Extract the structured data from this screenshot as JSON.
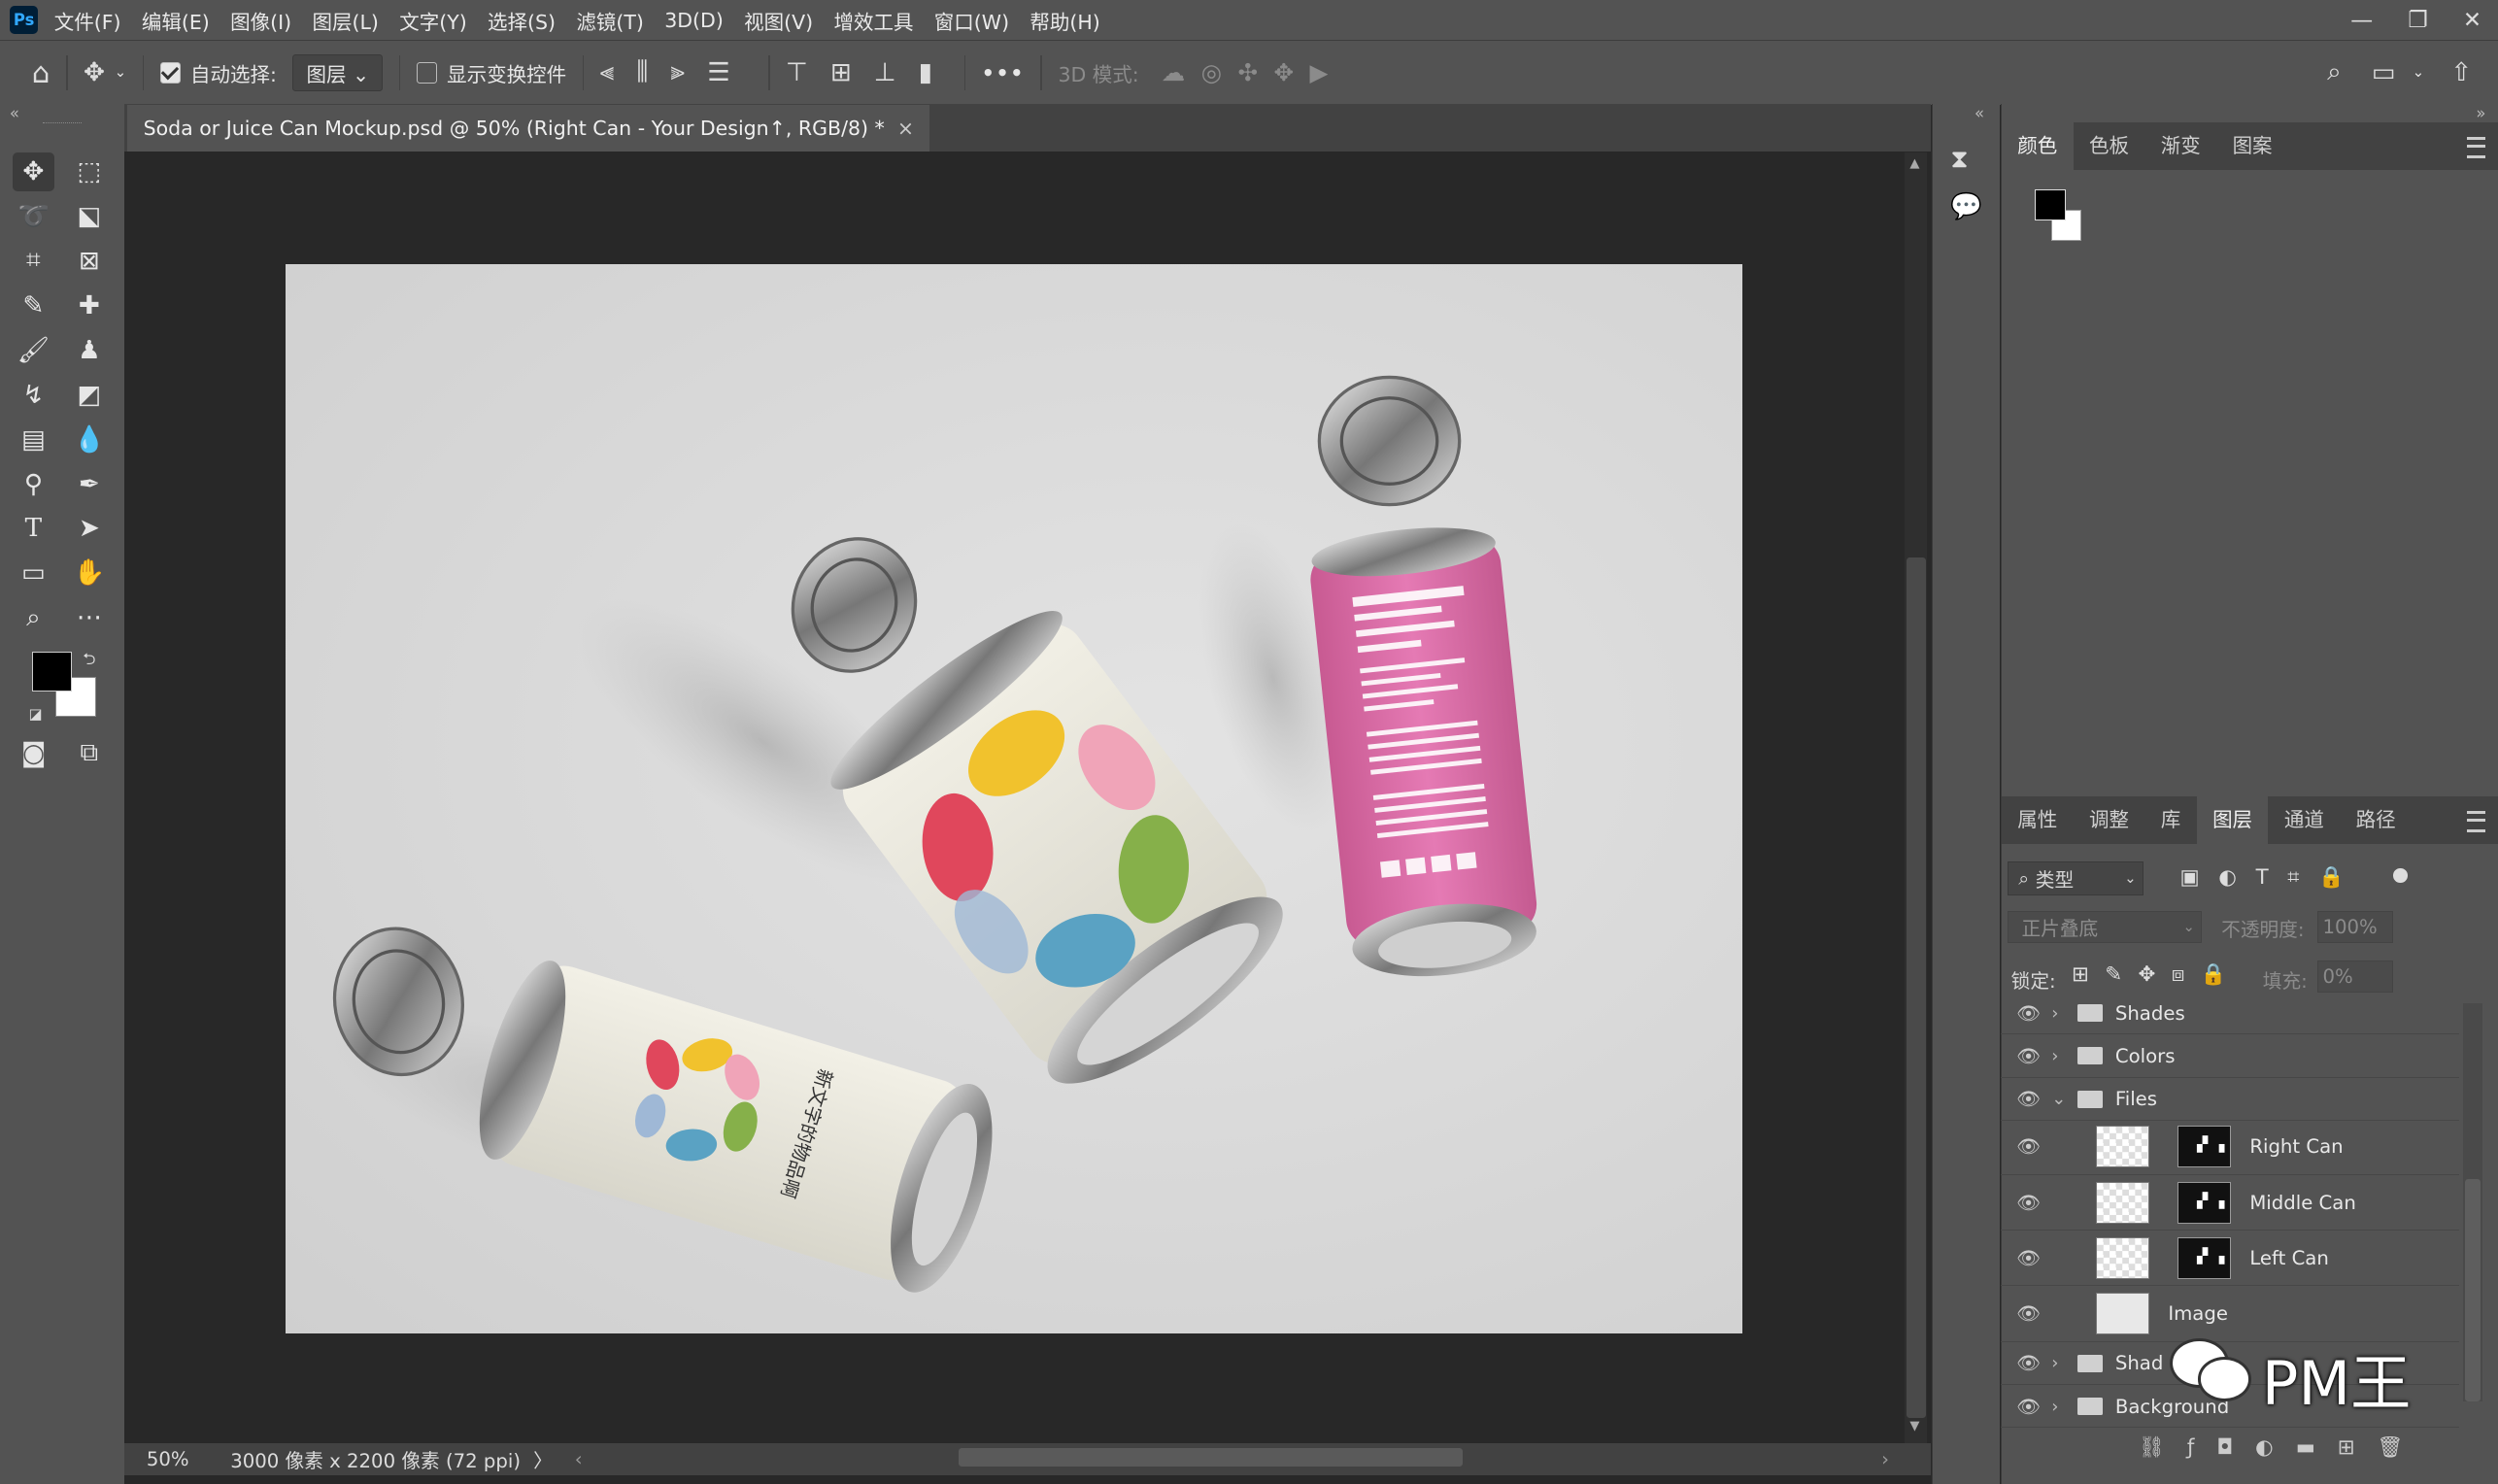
{
  "menubar": {
    "logo": "Ps",
    "items": [
      "文件(F)",
      "编辑(E)",
      "图像(I)",
      "图层(L)",
      "文字(Y)",
      "选择(S)",
      "滤镜(T)",
      "3D(D)",
      "视图(V)",
      "增效工具",
      "窗口(W)",
      "帮助(H)"
    ],
    "minimize": "—",
    "restore": "❐",
    "close": "✕"
  },
  "options": {
    "auto_select_label": "自动选择:",
    "auto_select_value": "图层",
    "show_transform_label": "显示变换控件",
    "mode_3d_label": "3D 模式:",
    "more": "•••"
  },
  "document": {
    "tab_title": "Soda or Juice Can Mockup.psd @ 50% (Right Can - Your Design↑, RGB/8) *",
    "tab_close": "×",
    "zoom": "50%",
    "doc_info": "3000 像素 x 2200 像素 (72 ppi)",
    "info_arrow": "〉"
  },
  "color_panel": {
    "tabs": [
      "颜色",
      "色板",
      "渐变",
      "图案"
    ],
    "fg_color": "#000000",
    "bg_color": "#ffffff"
  },
  "layers_panel": {
    "tabs": [
      "属性",
      "调整",
      "库",
      "图层",
      "通道",
      "路径"
    ],
    "filter_label": "类型",
    "blend_mode": "正片叠底",
    "opacity_label": "不透明度:",
    "opacity_value": "100%",
    "lock_label": "锁定:",
    "fill_label": "填充:",
    "fill_value": "0%",
    "layers": [
      {
        "name": "Shades",
        "kind": "group",
        "expanded": false
      },
      {
        "name": "Colors",
        "kind": "group",
        "expanded": false
      },
      {
        "name": "Files",
        "kind": "group",
        "expanded": true
      },
      {
        "name": "Right Can",
        "kind": "smart"
      },
      {
        "name": "Middle Can",
        "kind": "smart"
      },
      {
        "name": "Left Can",
        "kind": "smart"
      },
      {
        "name": "Image",
        "kind": "image"
      },
      {
        "name": "Shad",
        "kind": "group",
        "expanded": false
      },
      {
        "name": "Background",
        "kind": "group",
        "expanded": false
      }
    ]
  },
  "watermark": {
    "text": "PM王"
  },
  "canvas_art": {
    "can_text": "新文字的物品啊"
  }
}
